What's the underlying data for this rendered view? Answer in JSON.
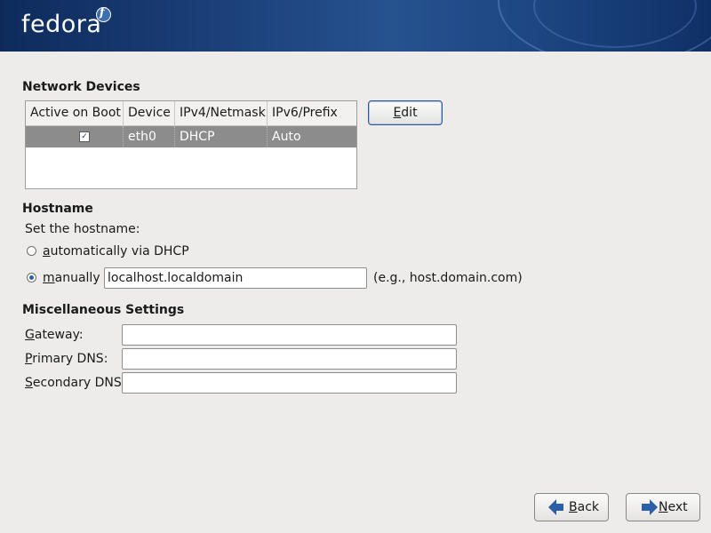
{
  "banner": {
    "logo_text": "fedora",
    "logo_mark": "f",
    "colors": {
      "banner_start": "#0e2b5c",
      "banner_mid": "#26528f"
    }
  },
  "network_devices": {
    "title": "Network Devices",
    "columns": [
      "Active on Boot",
      "Device",
      "IPv4/Netmask",
      "IPv6/Prefix"
    ],
    "rows": [
      {
        "active_on_boot": true,
        "active_mark": "✓",
        "device": "eth0",
        "ipv4": "DHCP",
        "ipv6": "Auto"
      }
    ],
    "edit_button": {
      "prefix": "",
      "underline": "E",
      "suffix": "dit"
    }
  },
  "hostname": {
    "title": "Hostname",
    "prompt": "Set the hostname:",
    "auto_option": {
      "underline": "a",
      "suffix": "utomatically via DHCP",
      "selected": false
    },
    "manual_option": {
      "underline": "m",
      "suffix": "anually",
      "selected": true
    },
    "manual_value": "localhost.localdomain",
    "example": "(e.g., host.domain.com)"
  },
  "misc": {
    "title": "Miscellaneous Settings",
    "gateway": {
      "underline": "G",
      "suffix": "ateway:",
      "value": ""
    },
    "primary_dns": {
      "underline": "P",
      "suffix": "rimary DNS:",
      "value": ""
    },
    "secondary_dns": {
      "underline": "S",
      "suffix": "econdary DNS:",
      "value": ""
    }
  },
  "footer": {
    "back_button": {
      "underline": "B",
      "suffix": "ack",
      "icon": "arrow-left-icon"
    },
    "next_button": {
      "underline": "N",
      "suffix": "ext",
      "icon": "arrow-right-icon"
    },
    "colors": {
      "arrow": "#2b5fa8"
    }
  }
}
